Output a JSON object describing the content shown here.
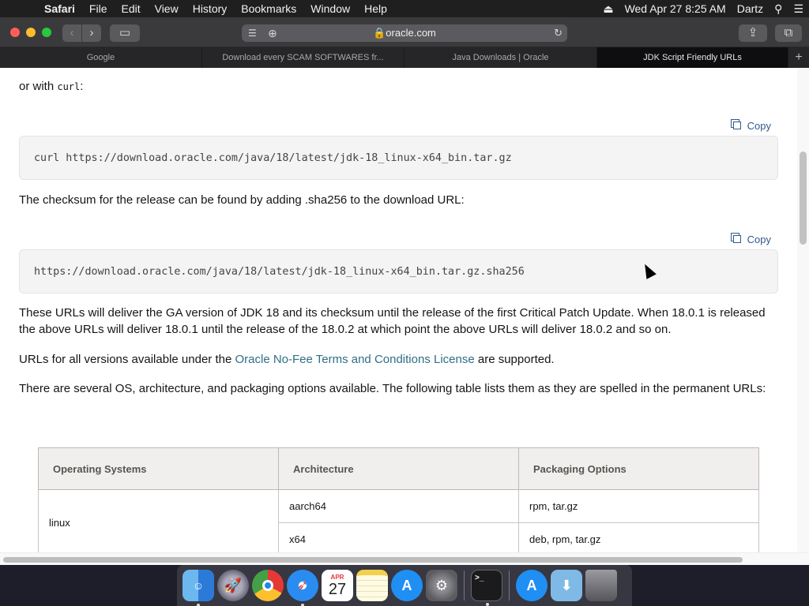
{
  "menubar": {
    "apple": "",
    "items": [
      "Safari",
      "File",
      "Edit",
      "View",
      "History",
      "Bookmarks",
      "Window",
      "Help"
    ],
    "clock": "Wed Apr 27  8:25 AM",
    "user": "Dartz",
    "eject_icon": "eject-icon",
    "search_icon": "spotlight-search-icon",
    "control_icon": "menu-list-icon"
  },
  "toolbar": {
    "back": "‹",
    "forward": "›",
    "sidebar": "▭",
    "reader": "☰",
    "new_tab_plus": "⊕",
    "url": "🔒oracle.com",
    "reload": "↻",
    "share": "⇪",
    "tabs_overview": "⧉"
  },
  "tabs": [
    {
      "label": "Google",
      "active": false
    },
    {
      "label": "Download every SCAM SOFTWARES fr...",
      "active": false
    },
    {
      "label": "Java Downloads | Oracle",
      "active": false
    },
    {
      "label": "JDK Script Friendly URLs",
      "active": true
    }
  ],
  "new_tab": "+",
  "content": {
    "intro_prefix": "or with ",
    "intro_code": "curl",
    "intro_suffix": ":",
    "copy_label": "Copy",
    "code1": "curl https://download.oracle.com/java/18/latest/jdk-18_linux-x64_bin.tar.gz",
    "checksum_text": "The checksum for the release can be found by adding .sha256 to the download URL:",
    "code2": "https://download.oracle.com/java/18/latest/jdk-18_linux-x64_bin.tar.gz.sha256",
    "ga_text": "These URLs will deliver the GA version of JDK 18 and its checksum until the release of the first Critical Patch Update. When 18.0.1 is released the above URLs will deliver 18.0.1 until the release of the 18.0.2 at which point the above URLs will deliver 18.0.2 and so on.",
    "license_prefix": "URLs for all versions available under the ",
    "license_link": "Oracle No-Fee Terms and Conditions License",
    "license_suffix": " are supported.",
    "options_text": "There are several OS, architecture, and packaging options available. The following table lists them as they are spelled in the permanent URLs:",
    "table": {
      "headers": [
        "Operating Systems",
        "Architecture",
        "Packaging Options"
      ],
      "os": "linux",
      "rows": [
        {
          "arch": "aarch64",
          "pkg": "rpm, tar.gz"
        },
        {
          "arch": "x64",
          "pkg": "deb, rpm, tar.gz"
        }
      ]
    }
  },
  "dock": {
    "apps": [
      "Finder",
      "Launchpad",
      "Chrome",
      "Safari",
      "Calendar",
      "Notes",
      "App Store",
      "System Preferences",
      "Terminal",
      "App Store",
      "Downloads",
      "Trash"
    ],
    "calendar_month": "APR",
    "calendar_day": "27",
    "terminal_prompt": ">_"
  },
  "colors": {
    "link": "#2f6f85",
    "copy": "#2f5b8c",
    "code_bg": "#f4f4f4",
    "table_header_bg": "#f1efed"
  }
}
